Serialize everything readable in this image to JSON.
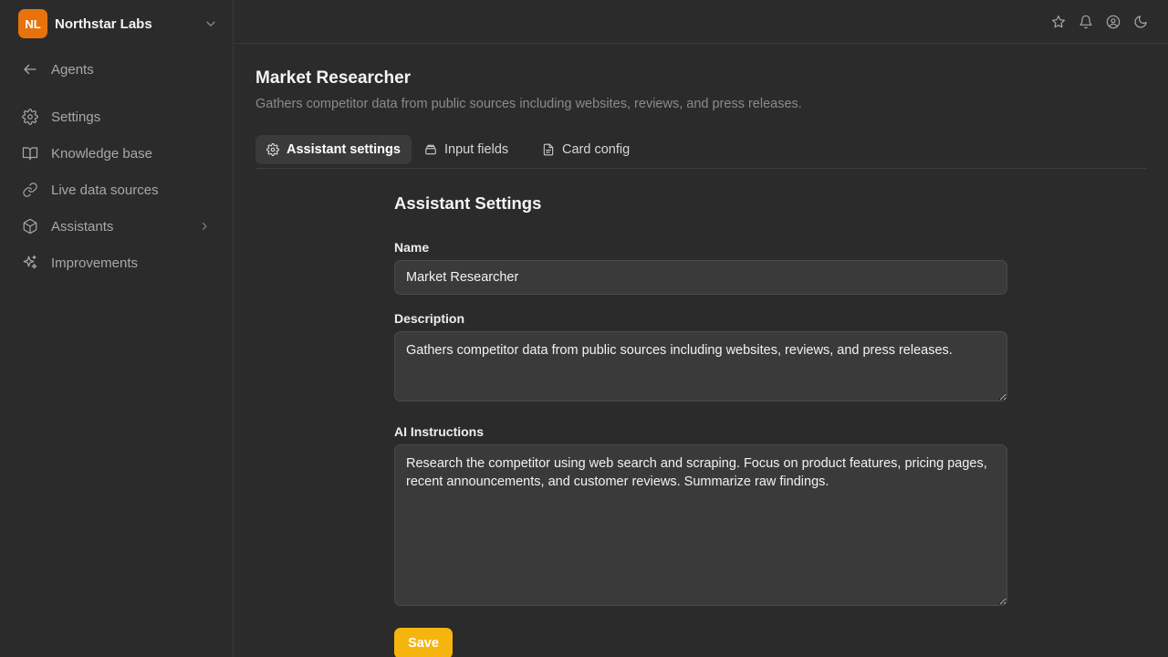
{
  "org": {
    "initials": "NL",
    "name": "Northstar Labs"
  },
  "sidebar": {
    "back_label": "Agents",
    "items": [
      {
        "label": "Settings",
        "icon": "gear-icon"
      },
      {
        "label": "Knowledge base",
        "icon": "book-icon"
      },
      {
        "label": "Live data sources",
        "icon": "link-icon"
      },
      {
        "label": "Assistants",
        "icon": "cube-icon"
      },
      {
        "label": "Improvements",
        "icon": "sparkles-icon"
      }
    ]
  },
  "topbar": {
    "icons": [
      "star-icon",
      "bell-icon",
      "user-circle-icon",
      "moon-icon"
    ]
  },
  "page": {
    "title": "Market Researcher",
    "description": "Gathers competitor data from public sources including websites, reviews, and press releases."
  },
  "tabs": [
    {
      "label": "Assistant settings",
      "icon": "gear-icon",
      "active": true
    },
    {
      "label": "Input fields",
      "icon": "stack-icon",
      "active": false
    },
    {
      "label": "Card config",
      "icon": "file-icon",
      "active": false
    }
  ],
  "form": {
    "section_title": "Assistant Settings",
    "name_label": "Name",
    "name_value": "Market Researcher",
    "description_label": "Description",
    "description_value": "Gathers competitor data from public sources including websites, reviews, and press releases.",
    "instructions_label": "AI Instructions",
    "instructions_value": "Research the competitor using web search and scraping. Focus on product features, pricing pages, recent announcements, and customer reviews. Summarize raw findings.",
    "save_label": "Save"
  },
  "colors": {
    "accent": "#f5b50e",
    "org_avatar": "#e8730c",
    "background": "#2b2b2b"
  }
}
